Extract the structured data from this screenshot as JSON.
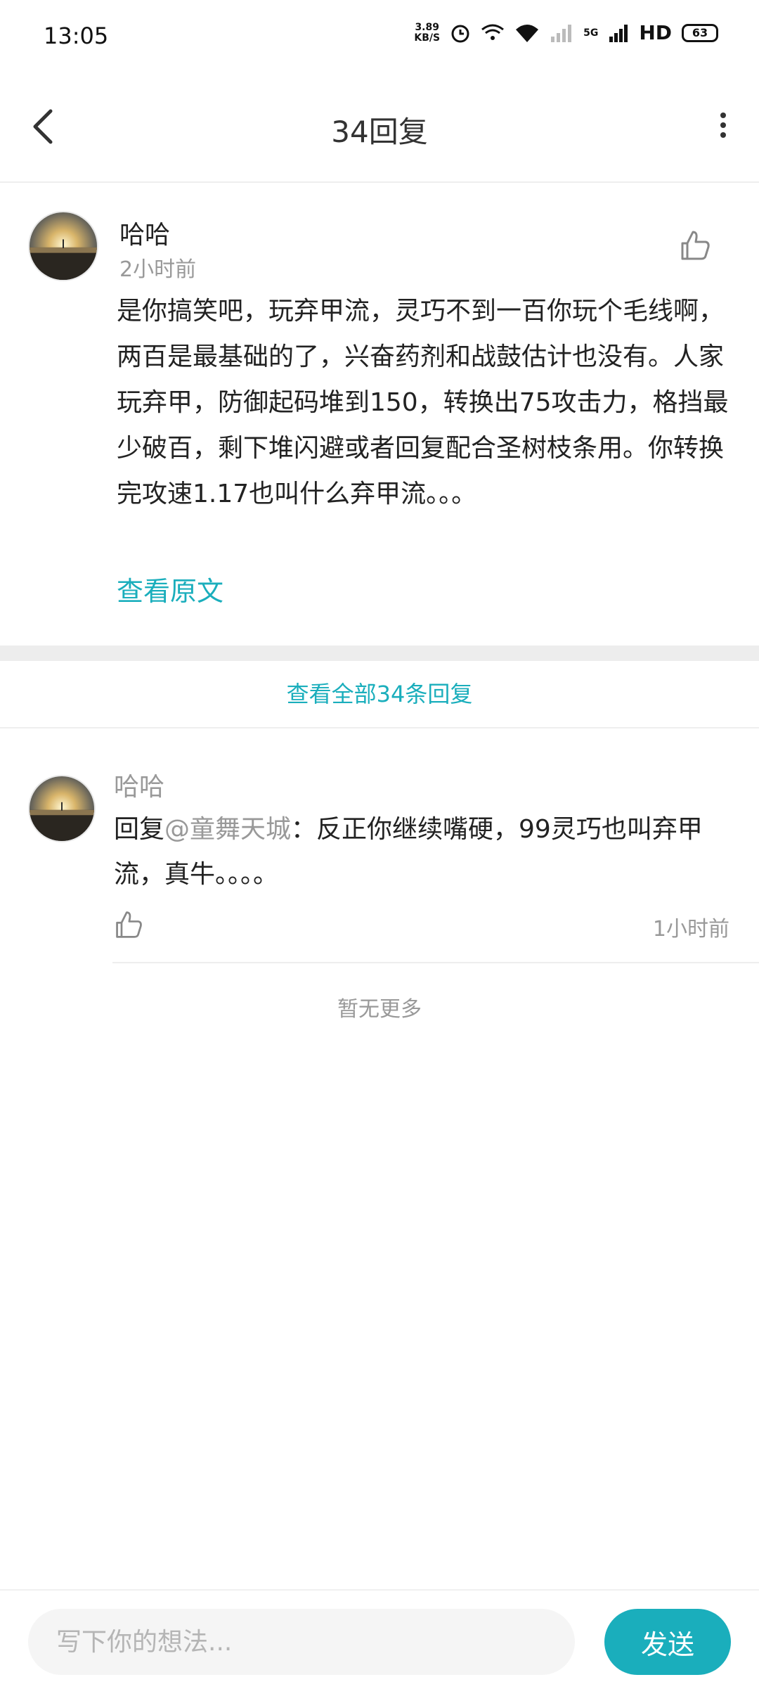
{
  "status_bar": {
    "time": "13:05",
    "net_speed_value": "3.89",
    "net_speed_unit": "KB/S",
    "network_label": "5G",
    "hd_label": "HD",
    "battery": "63"
  },
  "header": {
    "title": "34回复"
  },
  "main_comment": {
    "username": "哈哈",
    "time": "2小时前",
    "text": "是你搞笑吧，玩弃甲流，灵巧不到一百你玩个毛线啊，两百是最基础的了，兴奋药剂和战鼓估计也没有。人家玩弃甲，防御起码堆到150，转换出75攻击力，格挡最少破百，剩下堆闪避或者回复配合圣树枝条用。你转换完攻速1.17也叫什么弃甲流。。。",
    "view_original": "查看原文"
  },
  "view_all_replies": "查看全部34条回复",
  "reply": {
    "username": "哈哈",
    "prefix": "回复",
    "mention": "@童舞天城",
    "text": "：反正你继续嘴硬，99灵巧也叫弃甲流，真牛。。。。",
    "time": "1小时前"
  },
  "no_more": "暂无更多",
  "bottom_bar": {
    "input_placeholder": "写下你的想法...",
    "send_label": "发送"
  },
  "colors": {
    "accent": "#1aaebc",
    "muted_text": "#999999",
    "divider": "#ededed"
  },
  "icons": [
    "back-arrow-icon",
    "more-vertical-icon",
    "thumbs-up-icon",
    "alarm-icon",
    "wifi-icon",
    "signal-icon",
    "battery-icon"
  ]
}
